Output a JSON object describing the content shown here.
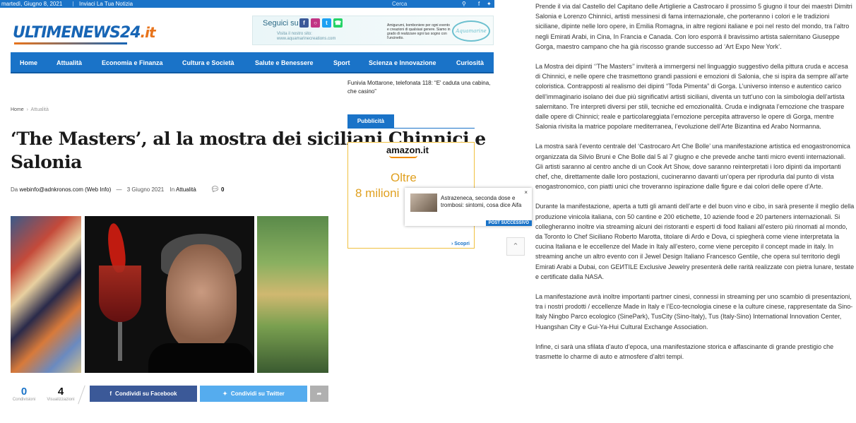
{
  "topbar": {
    "date": "martedì, Giugno 8, 2021",
    "invia": "Inviaci La Tua Notizia",
    "search_placeholder": "Cerca",
    "icons": [
      "search-icon",
      "facebook-icon",
      "twitter-icon"
    ]
  },
  "logo": {
    "part1": "ULTIMENEWS",
    "part2": "24",
    "part3": ".it"
  },
  "banner": {
    "seguici": "Seguici su",
    "visit": "Visita il nostro sito: www.aquamarinecreations.com",
    "amigurumi": "Amigurumi, bomboniere per ogni evento e creazioni di qualsiasi genere. Siamo in grado di realizzare ogni tuo sogno con l'uncinetto.",
    "brand": "Aquamarine"
  },
  "nav": [
    "Home",
    "Attualità",
    "Economia e Finanza",
    "Cultura e Società",
    "Salute e Benessere",
    "Sport",
    "Scienza e Innovazione",
    "Curiosità"
  ],
  "breadcrumb": {
    "home": "Home",
    "sep": "›",
    "current": "Attualità"
  },
  "article": {
    "title": "‘The Masters’, al la mostra dei siciliani Chinnici e Salonia",
    "meta_by": "Da",
    "author": "webinfo@adnkronos.com (Web Info)",
    "dash": "—",
    "date": "3 Giugno 2021",
    "in": "In",
    "category": "Attualità",
    "comments": "0",
    "paragraphs": [
      "Prende il via dal Castello del Capitano delle Artiglierie a Castrocaro il prossimo 5 giugno il tour dei maestri Dimitri Salonia e Lorenzo Chinnici, artisti messinesi di fama internazionale, che porteranno i colori e le tradizioni siciliane, dipinte nelle loro opere, in Emilia Romagna, in altre regioni italiane e poi nel resto del mondo, tra l’altro negli Emirati Arabi, in Cina, In Francia e Canada. Con loro esporrà il bravissimo artista salernitano Giuseppe Gorga, maestro campano che ha già riscosso grande successo ad ‘Art Expo New York’.",
      "La Mostra dei dipinti ‘’The Masters’’ inviterà a immergersi nel linguaggio suggestivo della pittura cruda e accesa di Chinnici, e nelle opere che trasmettono grandi passioni e emozioni di Salonia, che si ispira da sempre all’arte coloristica. Contrapposti al realismo dei dipinti “Toda Pimenta” di Gorga. L’universo intenso e autentico carico dell’immaginario isolano dei due più significativi artisti siciliani, diventa un tutt’uno con la simbologia dell’artista salernitano. Tre interpreti diversi per stili, tecniche ed emozionalità. Cruda e indignata l’emozione che traspare dalle opere di Chinnici; reale e particolareggiata l’emozione percepita attraverso le opere di Gorga, mentre Salonia rivisita la matrice popolare mediterranea, l’evoluzione dell’Arte Bizantina ed Arabo Normanna.",
      "La mostra sarà l’evento centrale del ‘Castrocaro Art Che Bolle’ una manifestazione artistica ed enogastronomica organizzata da Silvio Bruni e Che Bolle dal 5 al 7 giugno e che prevede anche tanti micro eventi internazionali. Gli artisti saranno al centro anche di un Cook Art Show, dove saranno reinterpretati i loro dipinti da importanti chef, che, direttamente dalle loro postazioni, cucineranno davanti un’opera per riprodurla dal punto di vista enogastronomico, con piatti unici che troveranno ispirazione dalle figure e dai colori delle opere d’Arte.",
      "Durante la manifestazione, aperta a tutti gli amanti dell’arte e del buon vino e cibo, in sarà presente il meglio della produzione vinicola italiana, con 50 cantine e 200 etichette, 10 aziende food e 20 parteners internazionali. Si collegheranno inoltre via streaming alcuni dei ristoranti e esperti di food Italiani all’estero più rinomati al mondo, da Toronto lo Chef Siciliano Roberto Marotta, titolare di Ardo e Dova, ci spiegherà come viene interpretata la cucina Italiana e le eccellenze del Made in Italy all’estero, come viene percepito il concept made in italy. In streaming anche un altro evento con il Jewel Design Italiano Francesco Gentile, che opera sul territorio degli Emirati Arabi a Dubai, con GEИTILE Exclusive Jewelry presenterà delle rarità realizzate con pietra lunare, testate e certificate dalla NASA.",
      "La manifestazione avrà inoltre importanti partner cinesi, connessi in streaming per uno scambio di presentazioni, tra i nostri prodotti / eccellenze Made in Italy e l’Eco-tecnologia cinese e la culture cinese, rappresentate da Sino-Italy Ningbo Parco ecologico (SinePark), TusCity (Sino-Italy), Tus (Italy-Sino) International Innovation Center, Huangshan City e Gui-Ya-Hui Cultural Exchange Association.",
      "Infine, ci sarà una sfilata d’auto d’epoca, una manifestazione storica e affascinante di grande prestigio che trasmette lo charme di auto e atmosfere d’altri tempi."
    ]
  },
  "counters": {
    "shares": {
      "value": "0",
      "label": "Condivisioni"
    },
    "views": {
      "value": "4",
      "label": "Visualizzazioni"
    }
  },
  "share": {
    "facebook": "Condividi su Facebook",
    "twitter": "Condividi su Twitter"
  },
  "sidebar": {
    "headline": "Funivia Mottarone, telefonata 118: “E' caduta una cabina, che casino”",
    "pubblicita": "Pubblicità",
    "amazon": {
      "brand": "amazon.it",
      "oltre": "Oltre",
      "milioni": "8 milioni",
      "scopri": "› Scopri"
    },
    "popup": {
      "text": "Astrazeneca, seconda dose e trombosi: sintomi, cosa dice Aifa",
      "close": "×",
      "tag": "POST SUCCESSIVO"
    }
  },
  "colors": {
    "brand_blue": "#1a73c8",
    "facebook": "#3b5998",
    "twitter": "#55acee",
    "share_more": "#b0b0b0",
    "logo_orange": "#e8741c"
  }
}
